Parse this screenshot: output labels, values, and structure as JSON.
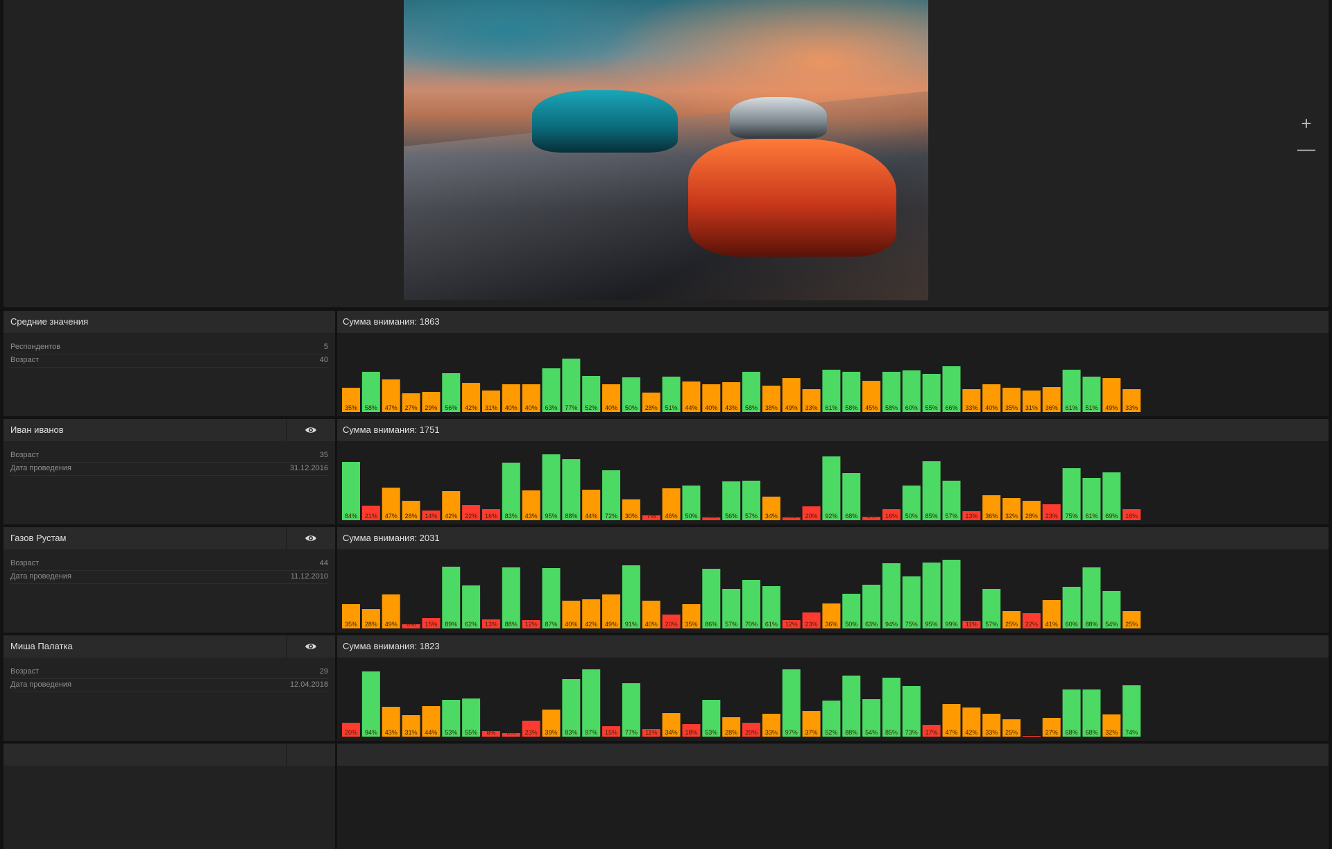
{
  "preview": {
    "image_alt": "",
    "zoom_in_label": "+",
    "zoom_out_label": "—"
  },
  "palette": {
    "green": "#4cd964",
    "orange": "#ff9a00",
    "red": "#ff3b30",
    "label_dark": "#3a2400"
  },
  "summary": {
    "title": "Средние значения",
    "fields": [
      {
        "label": "Респондентов",
        "value": "5"
      },
      {
        "label": "Возраст",
        "value": "40"
      }
    ],
    "chart_title": "Сумма внимания: 1863"
  },
  "respondents": [
    {
      "name": "Иван иванов",
      "fields": [
        {
          "label": "Возраст",
          "value": "35"
        },
        {
          "label": "Дата проведения",
          "value": "31.12.2016"
        }
      ],
      "chart_title": "Сумма внимания: 1751"
    },
    {
      "name": "Газов Рустам",
      "fields": [
        {
          "label": "Возраст",
          "value": "44"
        },
        {
          "label": "Дата проведения",
          "value": "11.12.2010"
        }
      ],
      "chart_title": "Сумма внимания: 2031"
    },
    {
      "name": "Миша Палатка",
      "fields": [
        {
          "label": "Возраст",
          "value": "29"
        },
        {
          "label": "Дата проведения",
          "value": "12.04.2018"
        }
      ],
      "chart_title": "Сумма внимания: 1823"
    }
  ],
  "chart_data": [
    {
      "type": "bar",
      "title": "Сумма внимания: 1863",
      "ylim": [
        0,
        100
      ],
      "values": [
        35,
        58,
        47,
        27,
        29,
        56,
        42,
        31,
        40,
        40,
        63,
        77,
        52,
        40,
        50,
        28,
        51,
        44,
        40,
        43,
        58,
        38,
        49,
        33,
        61,
        58,
        45,
        58,
        60,
        55,
        66,
        33,
        40,
        35,
        31,
        36,
        61,
        51,
        49,
        33
      ]
    },
    {
      "type": "bar",
      "title": "Сумма внимания: 1751",
      "ylim": [
        0,
        100
      ],
      "values": [
        84,
        21,
        47,
        28,
        14,
        42,
        22,
        16,
        83,
        43,
        95,
        88,
        44,
        72,
        30,
        7,
        46,
        50,
        4,
        56,
        57,
        34,
        4,
        20,
        92,
        68,
        5,
        16,
        50,
        85,
        57,
        13,
        36,
        32,
        28,
        23,
        75,
        61,
        69,
        16
      ]
    },
    {
      "type": "bar",
      "title": "Сумма внимания: 2031",
      "ylim": [
        0,
        100
      ],
      "values": [
        35,
        28,
        49,
        6,
        15,
        89,
        62,
        13,
        88,
        12,
        87,
        40,
        42,
        49,
        91,
        40,
        20,
        35,
        86,
        57,
        70,
        61,
        12,
        23,
        36,
        50,
        63,
        94,
        75,
        95,
        99,
        11,
        57,
        25,
        22,
        41,
        60,
        88,
        54,
        25
      ]
    },
    {
      "type": "bar",
      "title": "Сумма внимания: 1823",
      "ylim": [
        0,
        100
      ],
      "values": [
        20,
        94,
        43,
        31,
        44,
        53,
        55,
        8,
        5,
        23,
        39,
        83,
        97,
        15,
        77,
        11,
        34,
        18,
        53,
        28,
        20,
        33,
        97,
        37,
        52,
        88,
        54,
        85,
        73,
        17,
        47,
        42,
        33,
        25,
        1,
        27,
        68,
        68,
        32,
        74
      ]
    }
  ]
}
